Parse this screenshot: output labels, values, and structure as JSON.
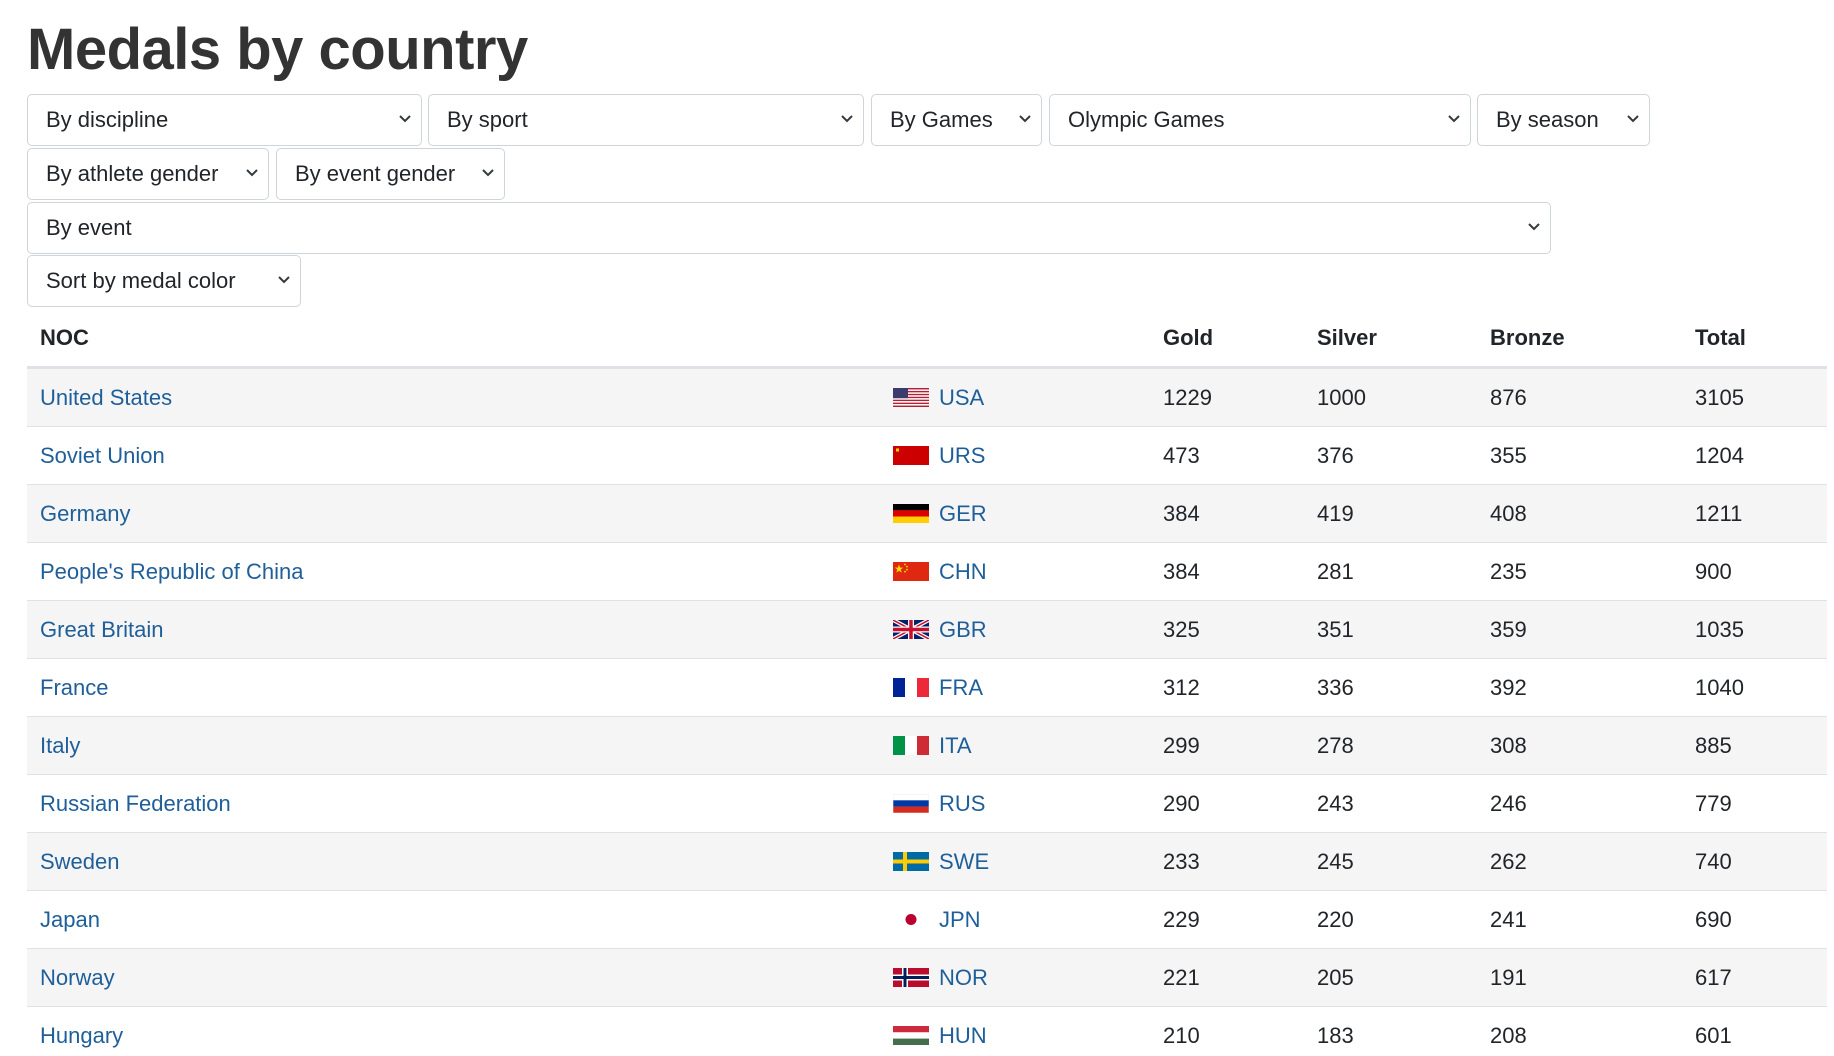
{
  "page": {
    "title": "Medals by country"
  },
  "filters": {
    "discipline": "By discipline",
    "sport": "By sport",
    "games": "By Games",
    "games_type": "Olympic Games",
    "season": "By season",
    "athlete_gender": "By athlete gender",
    "event_gender": "By event gender",
    "event": "By event",
    "sort": "Sort by medal color"
  },
  "table": {
    "headers": {
      "noc": "NOC",
      "gold": "Gold",
      "silver": "Silver",
      "bronze": "Bronze",
      "total": "Total"
    },
    "rows": [
      {
        "country": "United States",
        "code": "USA",
        "flag": "usa-flag-icon",
        "gold": "1229",
        "silver": "1000",
        "bronze": "876",
        "total": "3105"
      },
      {
        "country": "Soviet Union",
        "code": "URS",
        "flag": "urs-flag-icon",
        "gold": "473",
        "silver": "376",
        "bronze": "355",
        "total": "1204"
      },
      {
        "country": "Germany",
        "code": "GER",
        "flag": "ger-flag-icon",
        "gold": "384",
        "silver": "419",
        "bronze": "408",
        "total": "1211"
      },
      {
        "country": "People's Republic of China",
        "code": "CHN",
        "flag": "chn-flag-icon",
        "gold": "384",
        "silver": "281",
        "bronze": "235",
        "total": "900"
      },
      {
        "country": "Great Britain",
        "code": "GBR",
        "flag": "gbr-flag-icon",
        "gold": "325",
        "silver": "351",
        "bronze": "359",
        "total": "1035"
      },
      {
        "country": "France",
        "code": "FRA",
        "flag": "fra-flag-icon",
        "gold": "312",
        "silver": "336",
        "bronze": "392",
        "total": "1040"
      },
      {
        "country": "Italy",
        "code": "ITA",
        "flag": "ita-flag-icon",
        "gold": "299",
        "silver": "278",
        "bronze": "308",
        "total": "885"
      },
      {
        "country": "Russian Federation",
        "code": "RUS",
        "flag": "rus-flag-icon",
        "gold": "290",
        "silver": "243",
        "bronze": "246",
        "total": "779"
      },
      {
        "country": "Sweden",
        "code": "SWE",
        "flag": "swe-flag-icon",
        "gold": "233",
        "silver": "245",
        "bronze": "262",
        "total": "740"
      },
      {
        "country": "Japan",
        "code": "JPN",
        "flag": "jpn-flag-icon",
        "gold": "229",
        "silver": "220",
        "bronze": "241",
        "total": "690"
      },
      {
        "country": "Norway",
        "code": "NOR",
        "flag": "nor-flag-icon",
        "gold": "221",
        "silver": "205",
        "bronze": "191",
        "total": "617"
      },
      {
        "country": "Hungary",
        "code": "HUN",
        "flag": "hun-flag-icon",
        "gold": "210",
        "silver": "183",
        "bronze": "208",
        "total": "601"
      }
    ]
  },
  "colors": {
    "link": "#1f5f99",
    "title": "#333333",
    "stripe": "#f5f5f5",
    "border": "#dee2e6"
  }
}
